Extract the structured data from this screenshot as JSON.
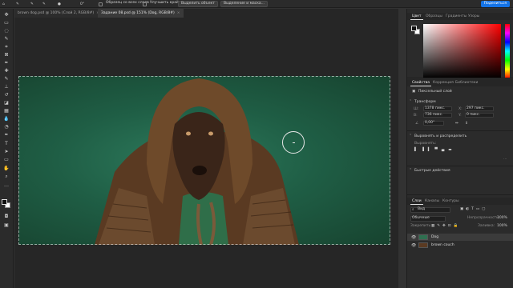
{
  "options_bar": {
    "sample_all_layers": "Образец со всех слоев",
    "refine_edge": "Улучшить край",
    "select_subject": "Выделить объект",
    "select_and_mask": "Выделение и маска...",
    "share": "Поделиться",
    "angle": "0°"
  },
  "tabs": [
    {
      "label": "brown dog.psd @ 100% (Слой 2, RGB/8#)"
    },
    {
      "label": "Задание 08.psd @ 151% (Dog, RGB/8#)"
    }
  ],
  "colors": {
    "accent": "#1473e6",
    "canvas_bg": "#1f5e45",
    "ui_dark": "#2b2b2b"
  },
  "color_panel": {
    "tabs": [
      "Цвет",
      "Образцы",
      "Градиенты",
      "Узоры"
    ]
  },
  "properties_panel": {
    "tabs": [
      "Свойства",
      "Коррекция",
      "Библиотеки"
    ],
    "layer_type": "Пиксельный слой",
    "transform_header": "Трансформ",
    "w_value": "1378 пикс.",
    "h_value": "736 пикс.",
    "x_value": "297 пикс.",
    "y_value": "0 пикс.",
    "angle_value": "0,00°",
    "align_header": "Выровнять и распределить",
    "align_label": "Выровнять:",
    "quick_actions": "Быстрые действия"
  },
  "layers_panel": {
    "tabs": [
      "Слои",
      "Каналы",
      "Контуры"
    ],
    "filter": "Вид",
    "blend_mode": "Обычные",
    "opacity_label": "Непрозрачность:",
    "opacity_value": "100%",
    "lock_label": "Закрепить:",
    "fill_label": "Заливка:",
    "fill_value": "100%",
    "layers": [
      {
        "name": "Dog",
        "selected": true
      },
      {
        "name": "brown couch",
        "selected": false
      }
    ]
  }
}
